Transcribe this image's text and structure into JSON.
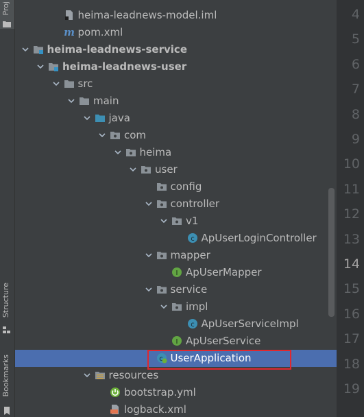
{
  "sidebar": {
    "project_tab": "Proj",
    "structure_tab": "Structure",
    "bookmarks_tab": "Bookmarks"
  },
  "tree": [
    {
      "label": "heima-leadnews-model.iml",
      "icon": "iml-file-icon",
      "depth": 3,
      "arrow": "none"
    },
    {
      "label": "pom.xml",
      "icon": "maven-icon",
      "depth": 3,
      "arrow": "none"
    },
    {
      "label": "heima-leadnews-service",
      "icon": "module-folder-icon",
      "depth": 1,
      "arrow": "down",
      "bold": true
    },
    {
      "label": "heima-leadnews-user",
      "icon": "module-folder-icon",
      "depth": 2,
      "arrow": "down",
      "bold": true
    },
    {
      "label": "src",
      "icon": "folder-icon",
      "depth": 3,
      "arrow": "down"
    },
    {
      "label": "main",
      "icon": "folder-icon",
      "depth": 4,
      "arrow": "down"
    },
    {
      "label": "java",
      "icon": "source-folder-icon",
      "depth": 5,
      "arrow": "down"
    },
    {
      "label": "com",
      "icon": "package-icon",
      "depth": 6,
      "arrow": "down"
    },
    {
      "label": "heima",
      "icon": "package-icon",
      "depth": 7,
      "arrow": "down"
    },
    {
      "label": "user",
      "icon": "package-icon",
      "depth": 8,
      "arrow": "down"
    },
    {
      "label": "config",
      "icon": "package-icon",
      "depth": 9,
      "arrow": "none"
    },
    {
      "label": "controller",
      "icon": "package-icon",
      "depth": 9,
      "arrow": "down"
    },
    {
      "label": "v1",
      "icon": "package-icon",
      "depth": 10,
      "arrow": "down"
    },
    {
      "label": "ApUserLoginController",
      "icon": "class-icon",
      "depth": 11,
      "arrow": "none"
    },
    {
      "label": "mapper",
      "icon": "package-icon",
      "depth": 9,
      "arrow": "down"
    },
    {
      "label": "ApUserMapper",
      "icon": "interface-icon",
      "depth": 10,
      "arrow": "none"
    },
    {
      "label": "service",
      "icon": "package-icon",
      "depth": 9,
      "arrow": "down"
    },
    {
      "label": "impl",
      "icon": "package-icon",
      "depth": 10,
      "arrow": "down"
    },
    {
      "label": "ApUserServiceImpl",
      "icon": "class-icon",
      "depth": 11,
      "arrow": "none"
    },
    {
      "label": "ApUserService",
      "icon": "interface-icon",
      "depth": 10,
      "arrow": "none"
    },
    {
      "label": "UserApplication",
      "icon": "spring-boot-class-icon",
      "depth": 9,
      "arrow": "none",
      "selected": true
    },
    {
      "label": "resources",
      "icon": "resources-folder-icon",
      "depth": 5,
      "arrow": "down"
    },
    {
      "label": "bootstrap.yml",
      "icon": "spring-config-icon",
      "depth": 6,
      "arrow": "none"
    },
    {
      "label": "logback.xml",
      "icon": "xml-file-icon",
      "depth": 6,
      "arrow": "none"
    }
  ],
  "gutter": {
    "line_numbers": [
      "4",
      "5",
      "6",
      "7",
      "8",
      "9",
      "10",
      "11",
      "12",
      "13",
      "14",
      "15",
      "16",
      "17",
      "18",
      "19"
    ],
    "current_line": "14"
  },
  "colors": {
    "selection": "#4b6eaf",
    "highlight_box": "#e0282f",
    "folder": "#8a9197",
    "source_folder": "#3d8fb3",
    "class": "#3c8fb3",
    "interface": "#62a543"
  }
}
